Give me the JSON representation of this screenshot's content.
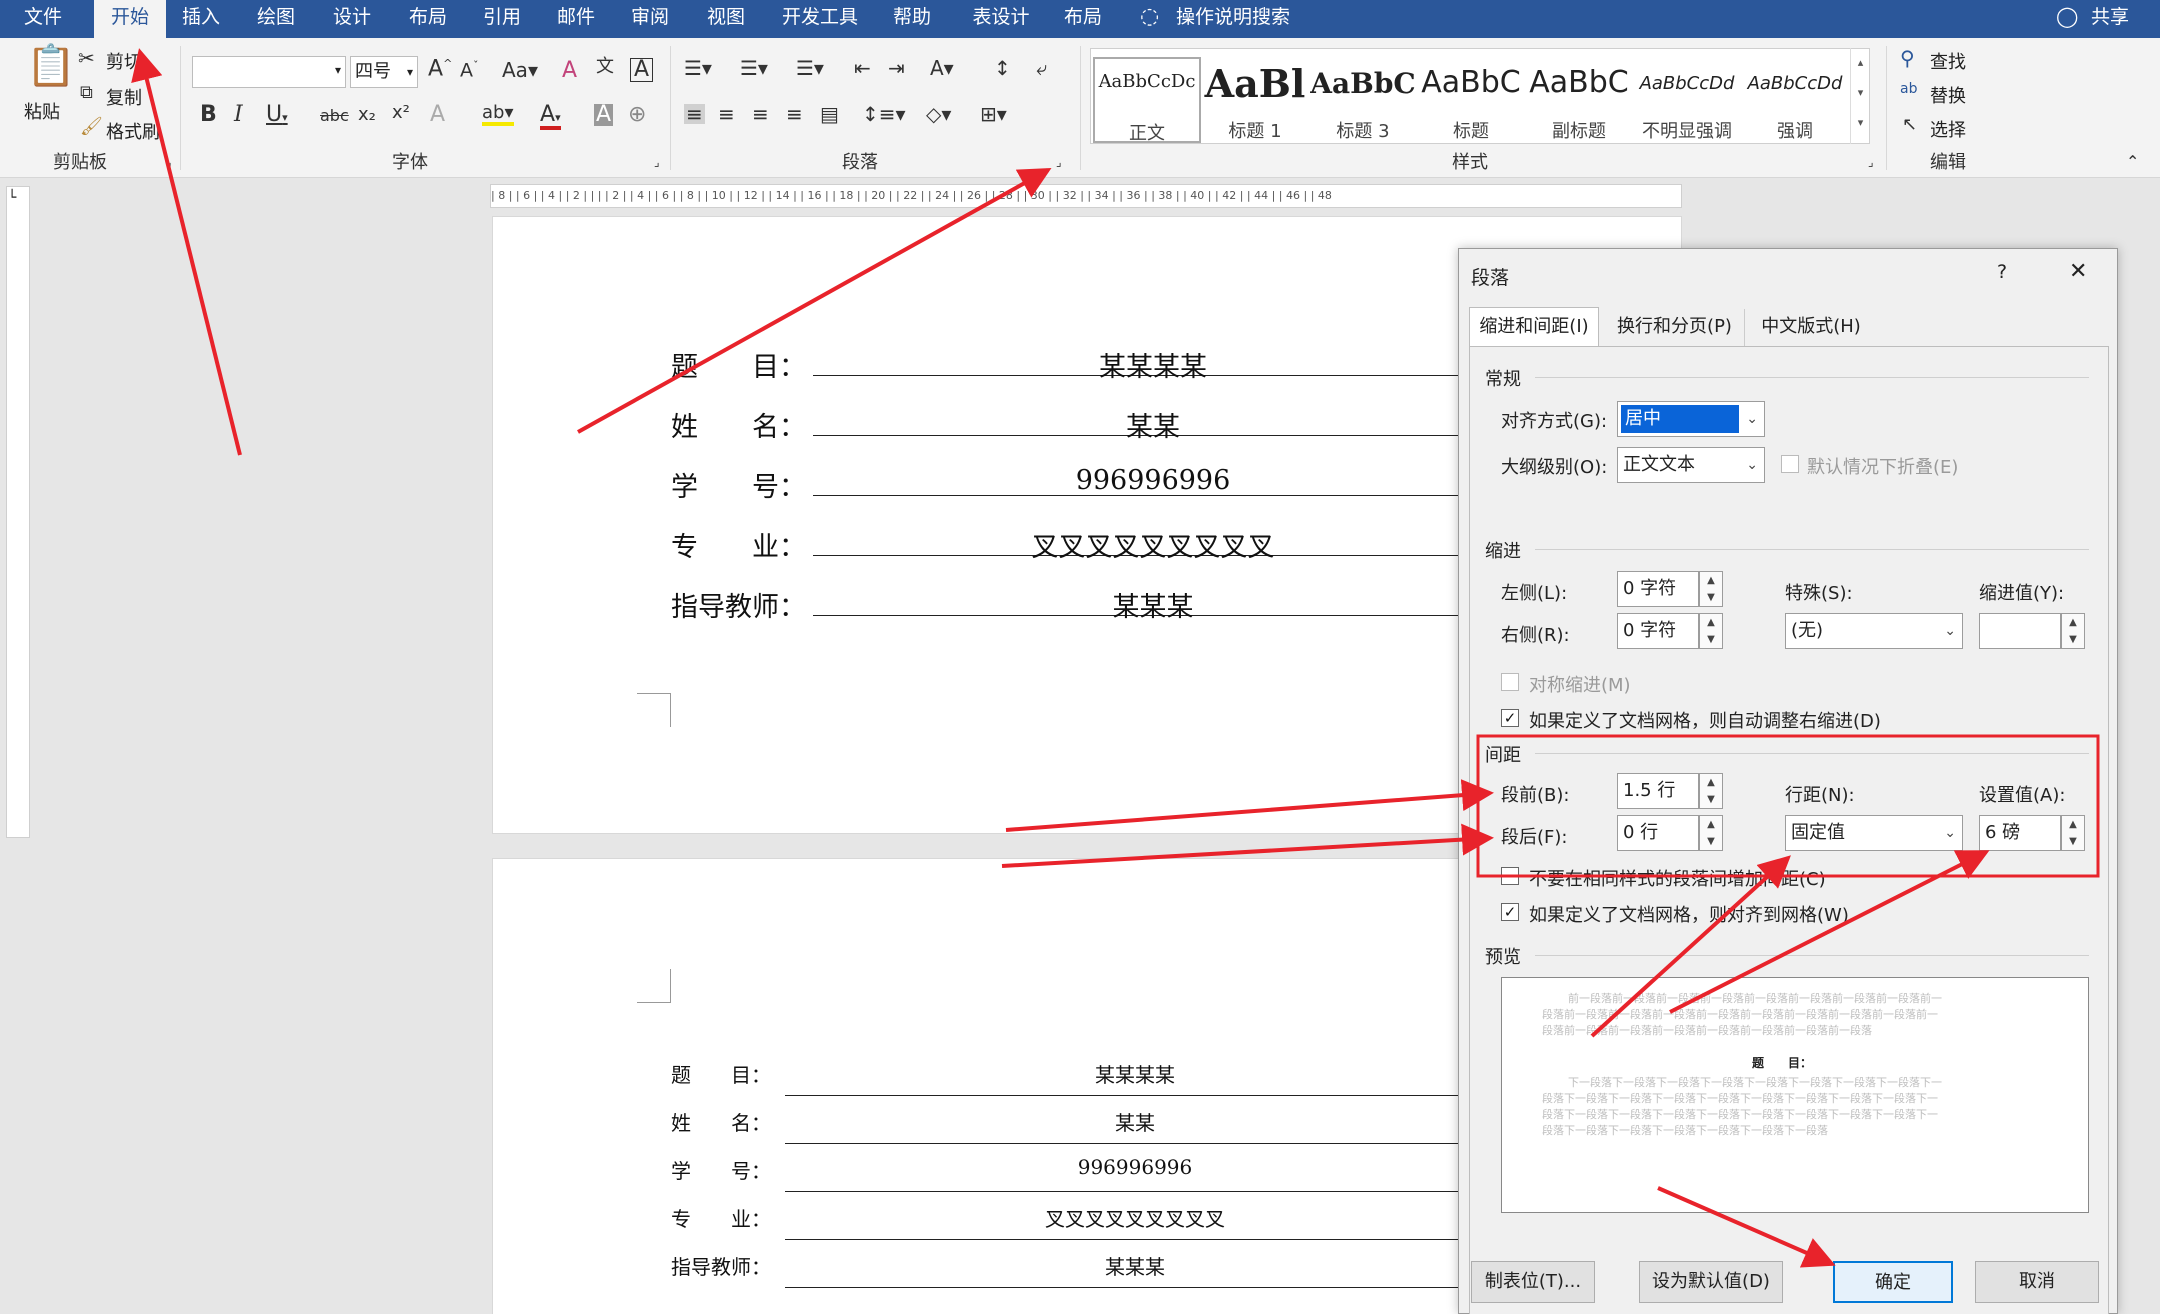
{
  "tabs": [
    "文件",
    "开始",
    "插入",
    "绘图",
    "设计",
    "布局",
    "引用",
    "邮件",
    "审阅",
    "视图",
    "开发工具",
    "帮助",
    "表设计",
    "布局"
  ],
  "search_label": "操作说明搜索",
  "share_label": "共享",
  "clipboard": {
    "paste": "粘贴",
    "cut": "剪切",
    "copy": "复制",
    "painter": "格式刷",
    "group": "剪贴板"
  },
  "font": {
    "name": "",
    "size": "四号",
    "group": "字体"
  },
  "paragraph": {
    "group": "段落"
  },
  "styles": {
    "group": "样式",
    "items": [
      {
        "preview": "AaBbCcDc",
        "name": "正文"
      },
      {
        "preview": "AaBl",
        "name": "标题 1"
      },
      {
        "preview": "AaBbC",
        "name": "标题 3"
      },
      {
        "preview": "AaBbC",
        "name": "标题"
      },
      {
        "preview": "AaBbC",
        "name": "副标题"
      },
      {
        "preview": "AaBbCcDd",
        "name": "不明显强调"
      },
      {
        "preview": "AaBbCcDd",
        "name": "强调"
      }
    ]
  },
  "editing": {
    "find": "查找",
    "replace": "替换",
    "select": "选择",
    "group": "编辑"
  },
  "ruler": "| 8 |   | 6 |   | 4 |   | 2 |   |      |   | 2 |   | 4 |   | 6 |   | 8 |   | 10 |   | 12 |   | 14 |   | 16 |   | 18 |   | 20 |   | 22 |   | 24 |   | 26 |   | 28 |   | 30 |   | 32 |   | 34 |   | 36 |   | 38 |   | 40 |   | 42 |   | 44 |   | 46 |   | 48",
  "doc": {
    "page1": [
      {
        "label": "题　　目：",
        "value": "某某某某"
      },
      {
        "label": "姓　　名：",
        "value": "某某"
      },
      {
        "label": "学　　号：",
        "value": "996996996"
      },
      {
        "label": "专　　业：",
        "value": "叉叉叉叉叉叉叉叉叉"
      },
      {
        "label": "指导教师：",
        "value": "某某某"
      }
    ],
    "page2": [
      {
        "label": "题　　目：",
        "value": "某某某某"
      },
      {
        "label": "姓　　名：",
        "value": "某某"
      },
      {
        "label": "学　　号：",
        "value": "996996996"
      },
      {
        "label": "专　　业：",
        "value": "叉叉叉叉叉叉叉叉叉"
      },
      {
        "label": "指导教师：",
        "value": "某某某"
      }
    ]
  },
  "dialog": {
    "title": "段落",
    "help": "?",
    "close": "✕",
    "tabs": [
      "缩进和间距(I)",
      "换行和分页(P)",
      "中文版式(H)"
    ],
    "general": "常规",
    "alignment_label": "对齐方式(G):",
    "alignment_value": "居中",
    "outline_label": "大纲级别(O):",
    "outline_value": "正文文本",
    "collapse_label": "默认情况下折叠(E)",
    "indent": "缩进",
    "left_label": "左侧(L):",
    "left_value": "0 字符",
    "right_label": "右侧(R):",
    "right_value": "0 字符",
    "special_label": "特殊(S):",
    "special_value": "(无)",
    "indent_by_label": "缩进值(Y):",
    "indent_by_value": "",
    "mirror_label": "对称缩进(M)",
    "auto_right_label": "如果定义了文档网格，则自动调整右缩进(D)",
    "spacing": "间距",
    "before_label": "段前(B):",
    "before_value": "1.5 行",
    "after_label": "段后(F):",
    "after_value": "0 行",
    "line_label": "行距(N):",
    "line_value": "固定值",
    "at_label": "设置值(A):",
    "at_value": "6 磅",
    "no_space_label": "不要在相同样式的段落间增加间距(C)",
    "snap_label": "如果定义了文档网格，则对齐到网格(W)",
    "preview": "预览",
    "pv_before": [
      "前一段落前一段落前一段落前一段落前一段落前一段落前一段落前一段落前一",
      "段落前一段落前一段落前一段落前一段落前一段落前一段落前一段落前一段落前一",
      "段落前一段落前一段落前一段落前一段落前一段落前一段落前一段落"
    ],
    "pv_sample": "题　　目：",
    "pv_after": [
      "下一段落下一段落下一段落下一段落下一段落下一段落下一段落下一段落下一",
      "段落下一段落下一段落下一段落下一段落下一段落下一段落下一段落下一段落下一",
      "段落下一段落下一段落下一段落下一段落下一段落下一段落下一段落下一段落下一",
      "段落下一段落下一段落下一段落下一段落下一段落下一段落"
    ],
    "tabs_btn": "制表位(T)...",
    "default_btn": "设为默认值(D)",
    "ok_btn": "确定",
    "cancel_btn": "取消"
  },
  "colors": {
    "accent": "#2b579a",
    "annotation": "#e8232b",
    "selection": "#0a64d8"
  }
}
